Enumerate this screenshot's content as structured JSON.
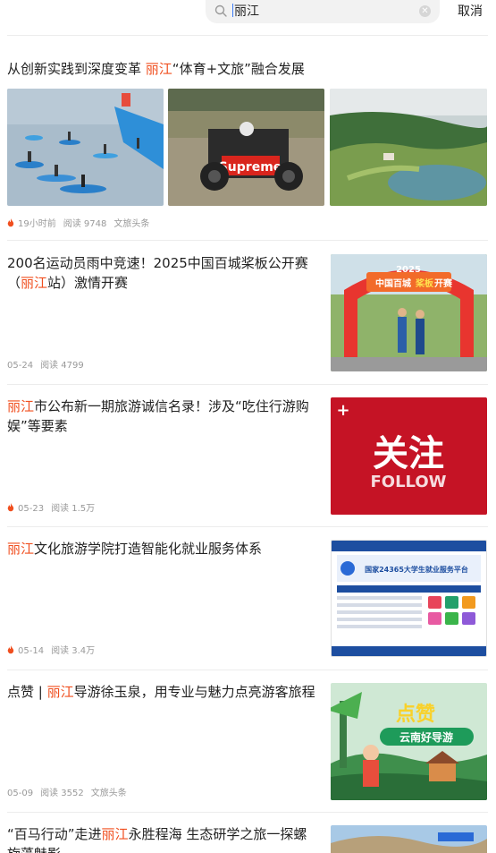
{
  "search": {
    "query": "丽江",
    "cancel_label": "取消"
  },
  "articles": [
    {
      "title_pre": "从创新实践到深度变革 ",
      "title_hl": "丽江",
      "title_post": "“体育+文旅”融合发展",
      "time": "19小时前",
      "reads": "阅读 9748",
      "source": "文旅头条",
      "hot": true,
      "image_texts": [
        "Supreme"
      ]
    },
    {
      "title_pre": "200名运动员雨中竞速！2025中国百城桨板公开赛（",
      "title_hl": "丽江",
      "title_post": "站）激情开赛",
      "time": "05-24",
      "reads": "阅读 4799",
      "hot": false,
      "image_texts": [
        "2025",
        "中国百城",
        "桨板",
        "开赛"
      ]
    },
    {
      "title_pre": "",
      "title_hl": "丽江",
      "title_post": "市公布新一期旅游诚信名录！涉及“吃住行游购娱”等要素",
      "time": "05-23",
      "reads": "阅读 1.5万",
      "hot": true,
      "image_texts": [
        "关注",
        "FOLLOW"
      ]
    },
    {
      "title_pre": "",
      "title_hl": "丽江",
      "title_post": "文化旅游学院打造智能化就业服务体系",
      "time": "05-14",
      "reads": "阅读 3.4万",
      "hot": true,
      "image_texts": [
        "国家24365大学生就业服务平台"
      ]
    },
    {
      "title_pre": "点赞 | ",
      "title_hl": "丽江",
      "title_post": "导游徐玉泉，用专业与魅力点亮游客旅程",
      "time": "05-09",
      "reads": "阅读 3552",
      "source": "文旅头条",
      "hot": false,
      "image_texts": [
        "点赞",
        "云南好导游"
      ]
    },
    {
      "title_pre": "“百马行动”走进",
      "title_hl": "丽江",
      "title_post": "永胜程海 生态研学之旅一探螺旋藻魅影"
    }
  ],
  "colors": {
    "highlight": "#f04f1f",
    "meta": "#999999",
    "caret": "#3b7bf6"
  }
}
